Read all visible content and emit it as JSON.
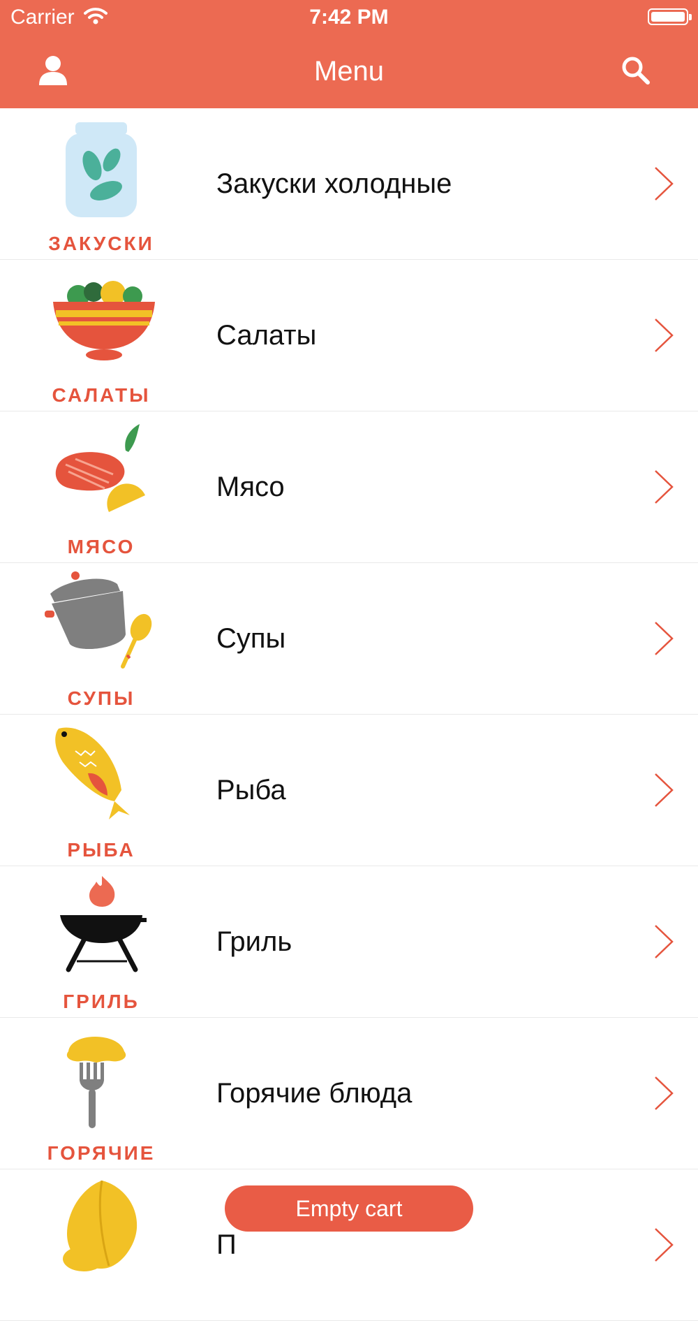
{
  "status_bar": {
    "carrier": "Carrier",
    "time": "7:42 PM"
  },
  "nav": {
    "title": "Menu"
  },
  "colors": {
    "accent": "#ec6a52",
    "category": "#e5543d",
    "cart": "#e95c46"
  },
  "menu": {
    "items": [
      {
        "category": "ЗАКУСКИ",
        "title": "Закуски холодные",
        "icon": "pickle-jar-icon"
      },
      {
        "category": "САЛАТЫ",
        "title": "Салаты",
        "icon": "salad-bowl-icon"
      },
      {
        "category": "МЯСО",
        "title": "Мясо",
        "icon": "steak-icon"
      },
      {
        "category": "СУПЫ",
        "title": "Супы",
        "icon": "soup-pot-icon"
      },
      {
        "category": "РЫБА",
        "title": "Рыба",
        "icon": "fish-icon"
      },
      {
        "category": "ГРИЛЬ",
        "title": "Гриль",
        "icon": "grill-icon"
      },
      {
        "category": "ГОРЯЧИЕ",
        "title": "Горячие блюда",
        "icon": "dumpling-fork-icon"
      },
      {
        "category": "",
        "title": "П",
        "icon": "pastry-icon"
      }
    ]
  },
  "cart": {
    "label": "Empty cart"
  }
}
